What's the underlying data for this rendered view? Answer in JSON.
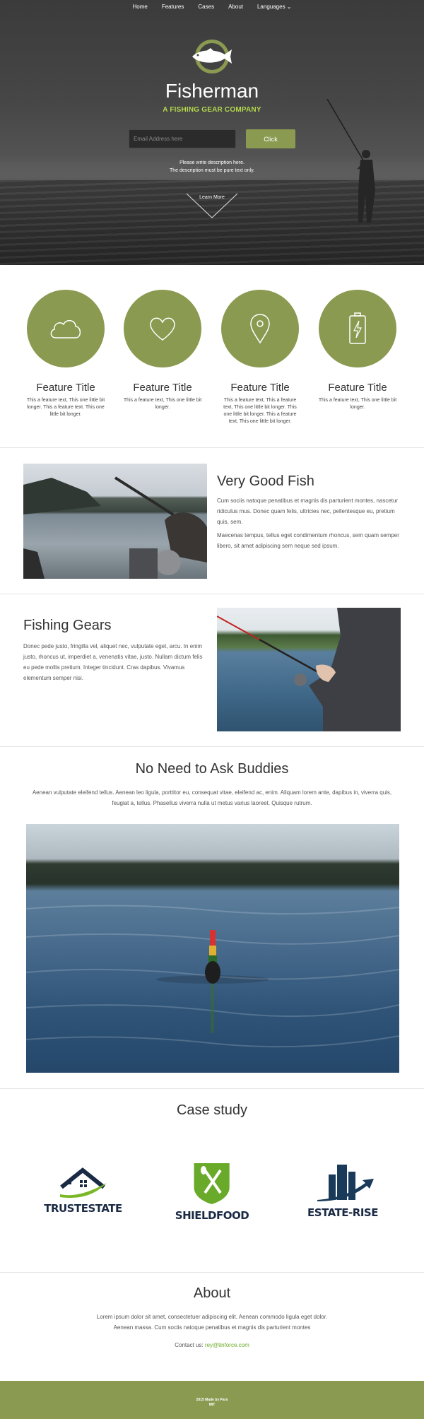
{
  "nav": {
    "items": [
      "Home",
      "Features",
      "Cases",
      "About",
      "Languages ⌄"
    ]
  },
  "hero": {
    "title": "Fisherman",
    "subtitle": "A FISHING GEAR COMPANY",
    "email_placeholder": "Email Address here",
    "button": "Click",
    "desc_line1": "Please write description here.",
    "desc_line2": "The description must be pure text only.",
    "learn_more": "Learn More"
  },
  "features": [
    {
      "icon": "cloud-icon",
      "title": "Feature Title",
      "text": "This a feature text, This one little bit longer. This a feature text. This one little bit longer."
    },
    {
      "icon": "heart-icon",
      "title": "Feature Title",
      "text": "This a feature text, This one little bit longer."
    },
    {
      "icon": "location-pin-icon",
      "title": "Feature Title",
      "text": "This a feature text, This a feature text, This one little bit longer. This one little bit longer. This a feature text, This one little bit longer."
    },
    {
      "icon": "battery-icon",
      "title": "Feature Title",
      "text": "This a feature text, This one little bit longer."
    }
  ],
  "good_fish": {
    "title": "Very Good Fish",
    "p1": "Cum sociis natoque penatibus et magnis dis parturient montes, nascetur ridiculus mus. Donec quam felis, ultricies nec, pellentesque eu, pretium quis, sem.",
    "p2": "Maecenas tempus, tellus eget condimentum rhoncus, sem quam semper libero, sit amet adipiscing sem neque sed ipsum."
  },
  "gears": {
    "title": "Fishing Gears",
    "p1": "Donec pede justo, fringilla vel, aliquet nec, vulputate eget, arcu. In enim justo, rhoncus ut, imperdiet a, venenatis vitae, justo. Nullam dictum felis eu pede mollis pretium. Integer tincidunt. Cras dapibus. Vivamus elementum semper nisi."
  },
  "buddies": {
    "title": "No Need to Ask Buddies",
    "text": "Aenean vulputate eleifend tellus. Aenean leo ligula, porttitor eu, consequat vitae, eleifend ac, enim. Aliquam lorem ante, dapibus in, viverra quis, feugiat a, tellus. Phasellus viverra nulla ut metus varius laoreet. Quisque rutrum."
  },
  "cases": {
    "title": "Case study",
    "logos": [
      "TRUSTESTATE",
      "SHIELDFOOD",
      "ESTATE-RISE"
    ]
  },
  "about": {
    "title": "About",
    "text": "Lorem ipsum dolor sit amet, consectetuer adipiscing elit. Aenean commodo ligula eget dolor. Aenean massa. Cum sociis natoque penatibus et magnis dis parturient montes",
    "contact_label": "Contact us:",
    "contact_email": "rey@tinforce.com"
  },
  "footer": {
    "line1": "2015 Made by Pars",
    "line2": "MIT"
  },
  "colors": {
    "accent": "#8a9a50",
    "highlight": "#b3d94d",
    "link": "#6aaa2a"
  }
}
